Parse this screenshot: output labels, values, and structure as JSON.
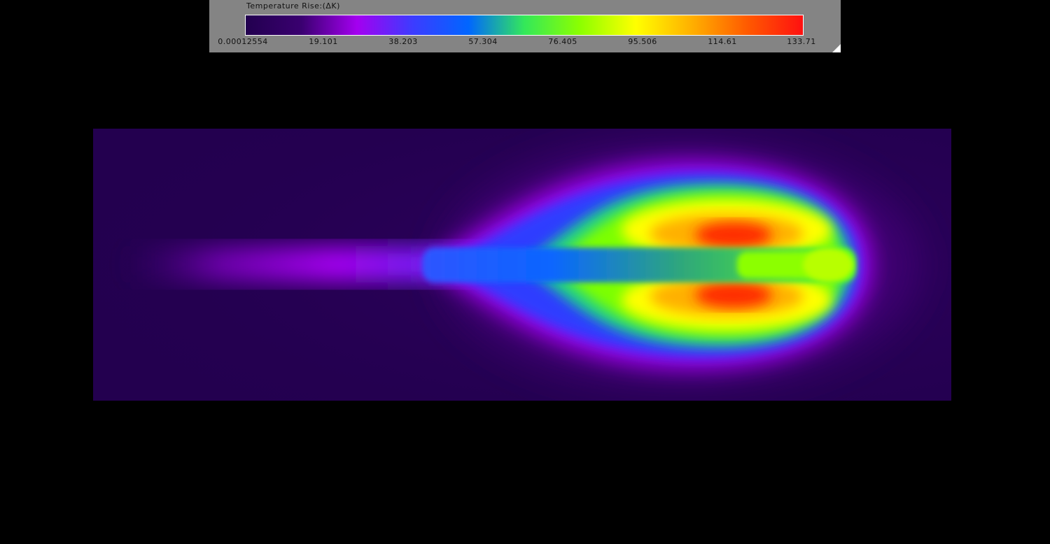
{
  "legend": {
    "title": "Temperature Rise:(ΔK)",
    "ticks": [
      {
        "label": "0.00012554",
        "value": 0.00012554
      },
      {
        "label": "19.101",
        "value": 19.101
      },
      {
        "label": "38.203",
        "value": 38.203
      },
      {
        "label": "57.304",
        "value": 57.304
      },
      {
        "label": "76.405",
        "value": 76.405
      },
      {
        "label": "95.506",
        "value": 95.506
      },
      {
        "label": "114.61",
        "value": 114.61
      },
      {
        "label": "133.71",
        "value": 133.71
      }
    ],
    "range": [
      0.00012554,
      133.71
    ]
  },
  "colormap": {
    "stops": [
      "#22004f",
      "#3a0070",
      "#a400f0",
      "#3c3cff",
      "#0066ff",
      "#33e85a",
      "#8cff00",
      "#ffff00",
      "#ffb000",
      "#ff5a00",
      "#ff1010"
    ],
    "background": "#23004f",
    "panel": "#848484",
    "canvas": "#000000"
  },
  "icons": {
    "resize": "resize-grip-icon"
  }
}
